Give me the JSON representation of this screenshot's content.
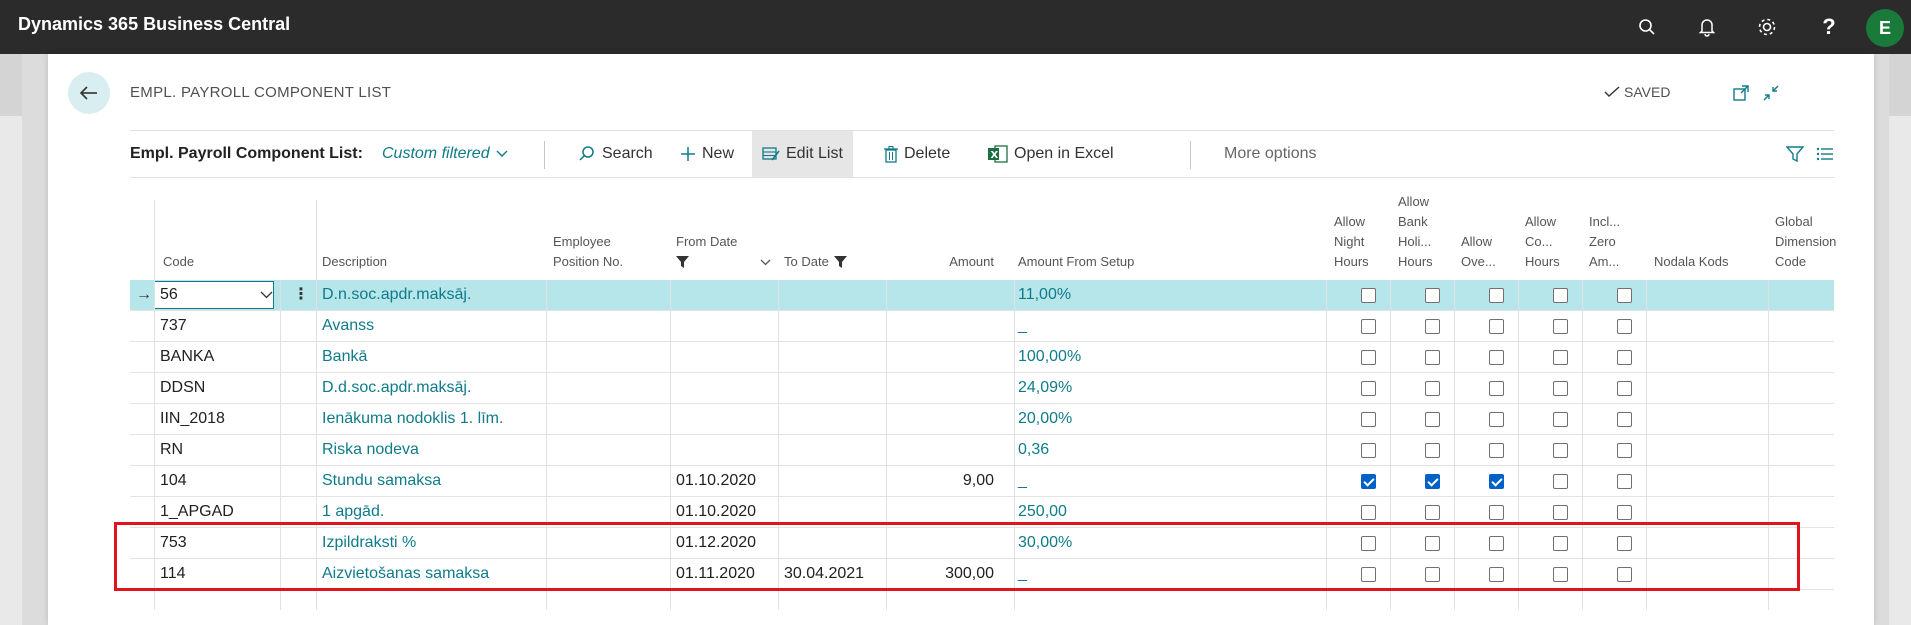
{
  "app": {
    "title": "Dynamics 365 Business Central",
    "avatar": "E"
  },
  "top_icons": [
    "search-icon",
    "bell-icon",
    "gear-icon",
    "help-icon"
  ],
  "page": {
    "title": "EMPL. PAYROLL COMPONENT LIST",
    "saved": "SAVED"
  },
  "actionbar": {
    "list_label": "Empl. Payroll Component List:",
    "filter_label": "Custom filtered",
    "search": "Search",
    "new": "New",
    "edit_list": "Edit List",
    "delete": "Delete",
    "open_excel": "Open in Excel",
    "more": "More options"
  },
  "columns": {
    "code": "Code",
    "description": "Description",
    "position_1": "Employee",
    "position_2": "Position No.",
    "from_date": "From Date",
    "to_date": "To Date",
    "amount": "Amount",
    "amount_setup": "Amount From Setup",
    "night_1": "Allow",
    "night_2": "Night",
    "night_3": "Hours",
    "bank_1": "Allow",
    "bank_2": "Bank",
    "bank_3": "Holi...",
    "bank_4": "Hours",
    "ove_1": "Allow",
    "ove_2": "Ove...",
    "co_1": "Allow",
    "co_2": "Co...",
    "co_3": "Hours",
    "zero_1": "Incl...",
    "zero_2": "Zero",
    "zero_3": "Am...",
    "nodala": "Nodala Kods",
    "dim_1": "Global",
    "dim_2": "Dimension",
    "dim_3": "Code"
  },
  "rows": [
    {
      "code": "56",
      "description": "D.n.soc.apdr.maksāj.",
      "from_date": "",
      "to_date": "",
      "amount": "",
      "amount_setup": "11,00%",
      "checks": [
        false,
        false,
        false,
        false,
        false
      ]
    },
    {
      "code": "737",
      "description": "Avanss",
      "from_date": "",
      "to_date": "",
      "amount": "",
      "amount_setup": "_",
      "checks": [
        false,
        false,
        false,
        false,
        false
      ]
    },
    {
      "code": "BANKA",
      "description": "Bankā",
      "from_date": "",
      "to_date": "",
      "amount": "",
      "amount_setup": "100,00%",
      "checks": [
        false,
        false,
        false,
        false,
        false
      ]
    },
    {
      "code": "DDSN",
      "description": "D.d.soc.apdr.maksāj.",
      "from_date": "",
      "to_date": "",
      "amount": "",
      "amount_setup": "24,09%",
      "checks": [
        false,
        false,
        false,
        false,
        false
      ]
    },
    {
      "code": "IIN_2018",
      "description": "Ienākuma nodoklis 1. līm.",
      "from_date": "",
      "to_date": "",
      "amount": "",
      "amount_setup": "20,00%",
      "checks": [
        false,
        false,
        false,
        false,
        false
      ]
    },
    {
      "code": "RN",
      "description": "Riska nodeva",
      "from_date": "",
      "to_date": "",
      "amount": "",
      "amount_setup": "0,36",
      "checks": [
        false,
        false,
        false,
        false,
        false
      ]
    },
    {
      "code": "104",
      "description": "Stundu samaksa",
      "from_date": "01.10.2020",
      "to_date": "",
      "amount": "9,00",
      "amount_setup": "_",
      "checks": [
        true,
        true,
        true,
        false,
        false
      ]
    },
    {
      "code": "1_APGAD",
      "description": "1 apgād.",
      "from_date": "01.10.2020",
      "to_date": "",
      "amount": "",
      "amount_setup": "250,00",
      "checks": [
        false,
        false,
        false,
        false,
        false
      ]
    },
    {
      "code": "753",
      "description": "Izpildraksti %",
      "from_date": "01.12.2020",
      "to_date": "",
      "amount": "",
      "amount_setup": "30,00%",
      "checks": [
        false,
        false,
        false,
        false,
        false
      ]
    },
    {
      "code": "114",
      "description": "Aizvietošanas samaksa",
      "from_date": "01.11.2020",
      "to_date": "30.04.2021",
      "amount": "300,00",
      "amount_setup": "_",
      "checks": [
        false,
        false,
        false,
        false,
        false
      ]
    }
  ],
  "colors": {
    "accent": "#0f7b8a",
    "selected_row": "#b7e6ea",
    "highlight": "#e0141c",
    "appbar": "#2b2b2b"
  }
}
